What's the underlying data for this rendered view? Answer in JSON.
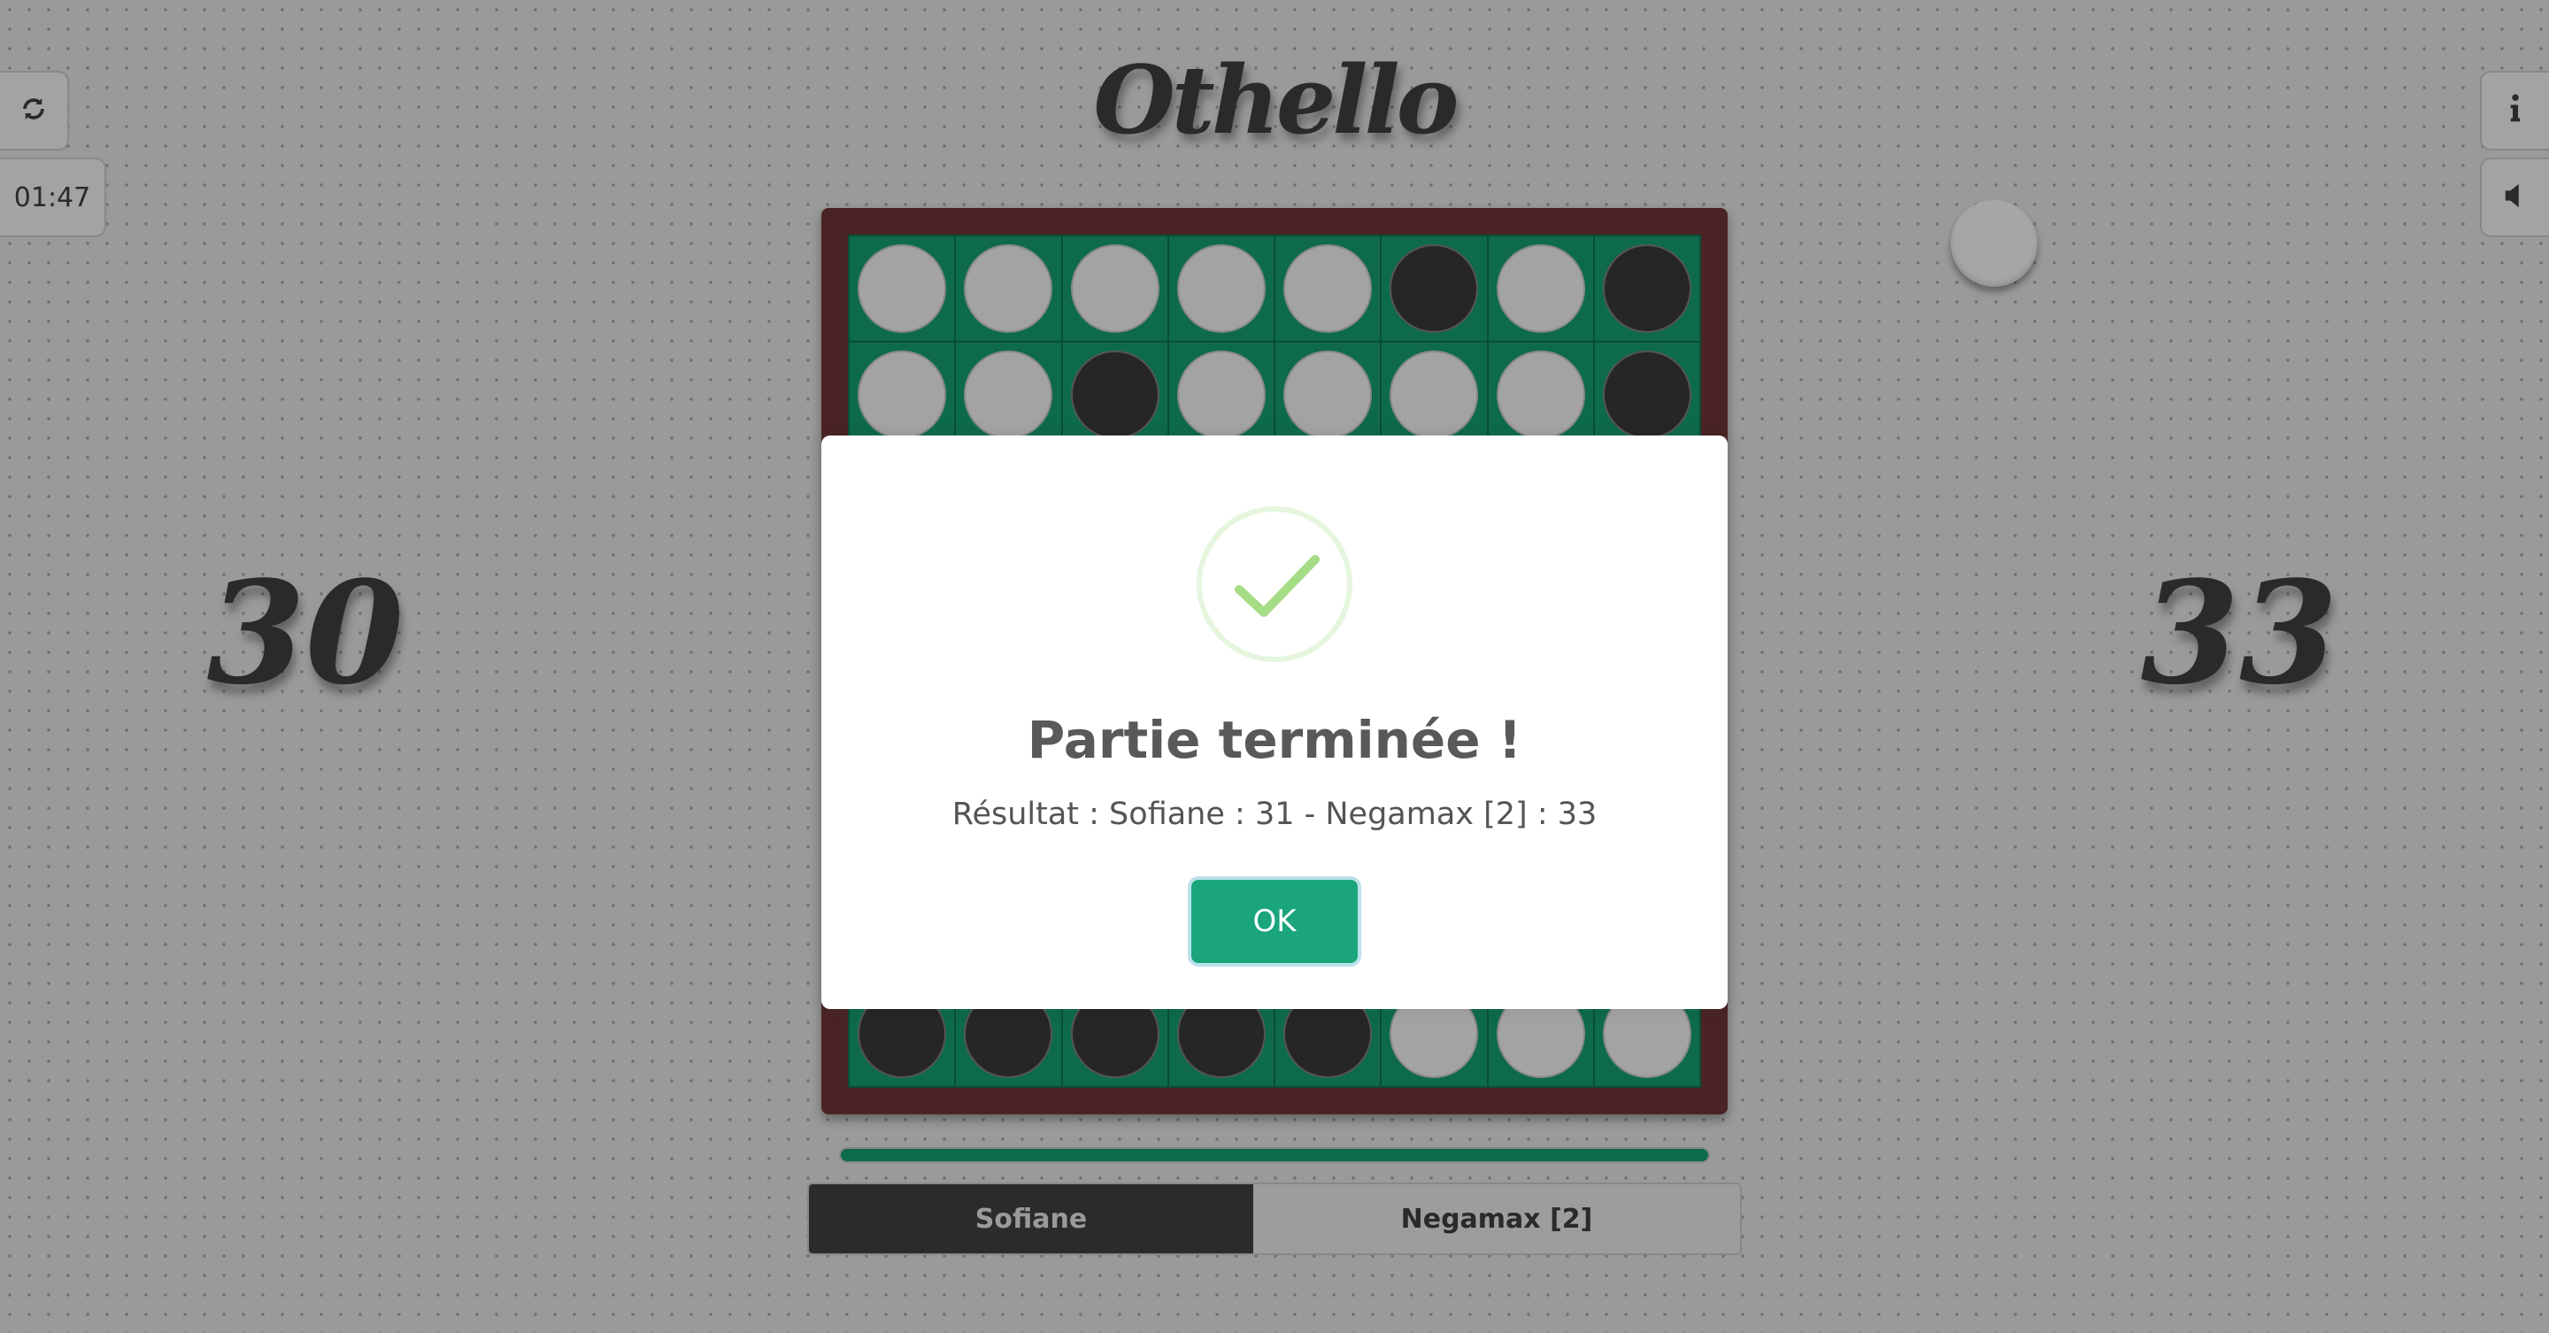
{
  "header": {
    "logo_text": "Othello"
  },
  "controls": {
    "refresh_icon": "refresh-icon",
    "timer": "01:47",
    "info_icon": "info-icon",
    "sound_icon": "speaker-icon"
  },
  "scores": {
    "left": "30",
    "right": "33"
  },
  "colors": {
    "board": "#0e6a4c",
    "frame": "#4a2424",
    "ok_button": "#1aa67a",
    "black_disc": "#262626",
    "white_disc": "#a3a3a3"
  },
  "board": {
    "visible_rows": [
      [
        "w",
        "w",
        "w",
        "w",
        "w",
        "b",
        "w",
        "b"
      ],
      [
        "w",
        "w",
        "b",
        "w",
        "w",
        "w",
        "w",
        "b"
      ],
      [
        "b",
        "b",
        "b",
        "b",
        "b",
        "w",
        "w",
        "w"
      ]
    ]
  },
  "players": {
    "player1": "Sofiane",
    "player2": "Negamax [2]",
    "active": "player1"
  },
  "dialog": {
    "icon": "success-check-icon",
    "title": "Partie terminée !",
    "text": "Résultat : Sofiane : 31 - Negamax [2] : 33",
    "ok_label": "OK"
  }
}
